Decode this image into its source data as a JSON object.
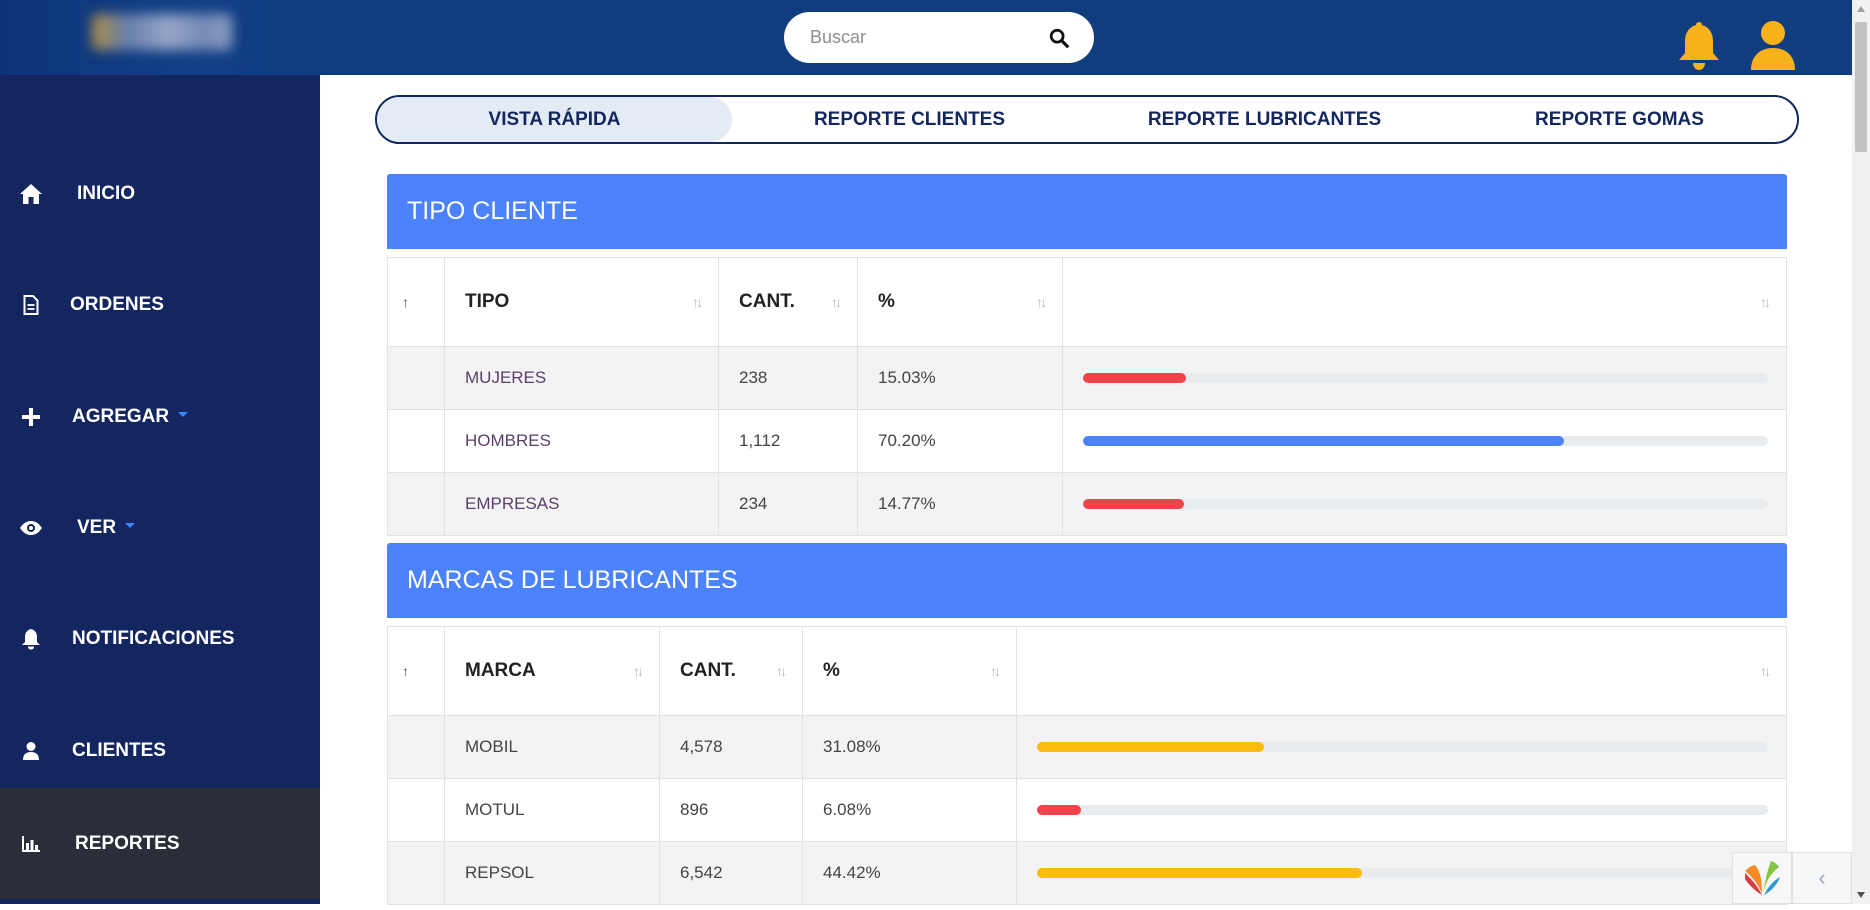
{
  "header": {
    "search_placeholder": "Buscar"
  },
  "sidebar": {
    "items": [
      {
        "label": "INICIO",
        "icon": "home-icon"
      },
      {
        "label": "ORDENES",
        "icon": "document-icon"
      },
      {
        "label": "AGREGAR",
        "icon": "plus-icon"
      },
      {
        "label": "VER",
        "icon": "eye-icon"
      },
      {
        "label": "NOTIFICACIONES",
        "icon": "bell-icon"
      },
      {
        "label": "CLIENTES",
        "icon": "user-icon"
      },
      {
        "label": "REPORTES",
        "icon": "bar-chart-icon"
      }
    ]
  },
  "tabs": [
    {
      "label": "VISTA RÁPIDA"
    },
    {
      "label": "REPORTE CLIENTES"
    },
    {
      "label": "REPORTE LUBRICANTES"
    },
    {
      "label": "REPORTE GOMAS"
    }
  ],
  "tipo_cliente": {
    "title": "TIPO CLIENTE",
    "headers": {
      "col1": "TIPO",
      "col2": "CANT.",
      "col3": "%"
    },
    "rows": [
      {
        "name": "MUJERES",
        "count": "238",
        "percent": "15.03%",
        "fill": 15.03,
        "color": "#f0434a"
      },
      {
        "name": "HOMBRES",
        "count": "1,112",
        "percent": "70.20%",
        "fill": 70.2,
        "color": "#4c82fb"
      },
      {
        "name": "EMPRESAS",
        "count": "234",
        "percent": "14.77%",
        "fill": 14.77,
        "color": "#f0434a"
      }
    ]
  },
  "marcas": {
    "title": "MARCAS DE LUBRICANTES",
    "headers": {
      "col1": "MARCA",
      "col2": "CANT.",
      "col3": "%"
    },
    "rows": [
      {
        "name": "MOBIL",
        "count": "4,578",
        "percent": "31.08%",
        "fill": 31.08,
        "color": "#fbbb10"
      },
      {
        "name": "MOTUL",
        "count": "896",
        "percent": "6.08%",
        "fill": 6.08,
        "color": "#f0434a"
      },
      {
        "name": "REPSOL",
        "count": "6,542",
        "percent": "44.42%",
        "fill": 44.42,
        "color": "#fbbb10"
      }
    ]
  },
  "colors": {
    "navy": "#13265f",
    "topbar": "#0f3d7e",
    "accent_blue": "#4c82fb",
    "icon_yellow": "#f7b21b",
    "red": "#f0434a",
    "yellow": "#fbbb10"
  }
}
